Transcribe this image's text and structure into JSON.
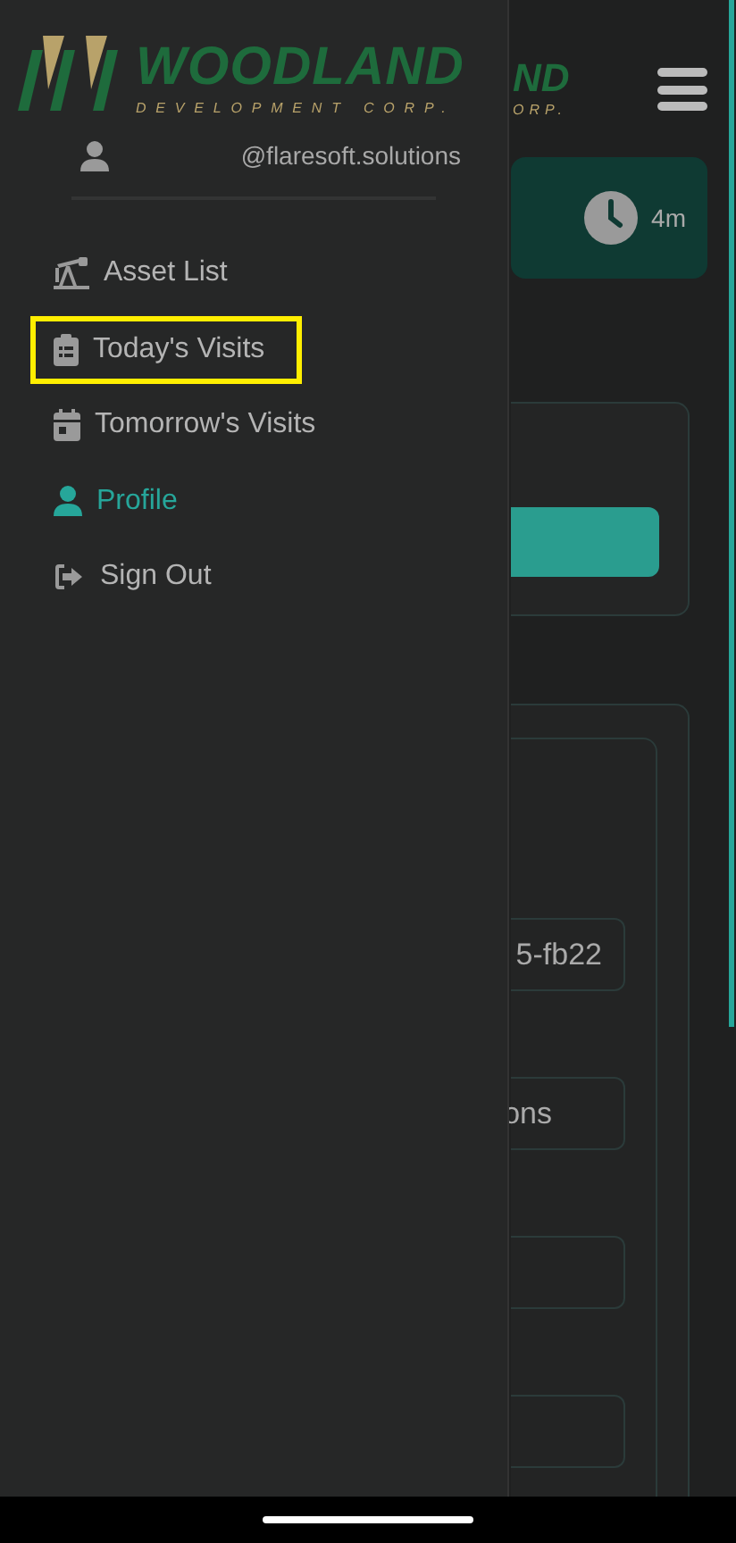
{
  "background_page": {
    "logo_fragment": "ND",
    "logo_tagline_fragment": "ORP.",
    "timer": {
      "reading": "4m"
    },
    "fields": [
      {
        "kind": "text",
        "value": "5-fb22"
      },
      {
        "kind": "text",
        "value": "ons"
      },
      {
        "kind": "blank"
      },
      {
        "kind": "blank"
      }
    ]
  },
  "drawer": {
    "logo": {
      "name": "WOODLAND",
      "tagline": "DEVELOPMENT CORP."
    },
    "user": "@flaresoft.solutions",
    "items": [
      {
        "label": "Asset List",
        "selected": false,
        "highlighted": false
      },
      {
        "label": "Today's Visits",
        "selected": false,
        "highlighted": true
      },
      {
        "label": "Tomorrow's Visits",
        "selected": false,
        "highlighted": false
      },
      {
        "label": "Profile",
        "selected": true,
        "highlighted": false
      },
      {
        "label": "Sign Out",
        "selected": false,
        "highlighted": false
      }
    ]
  }
}
